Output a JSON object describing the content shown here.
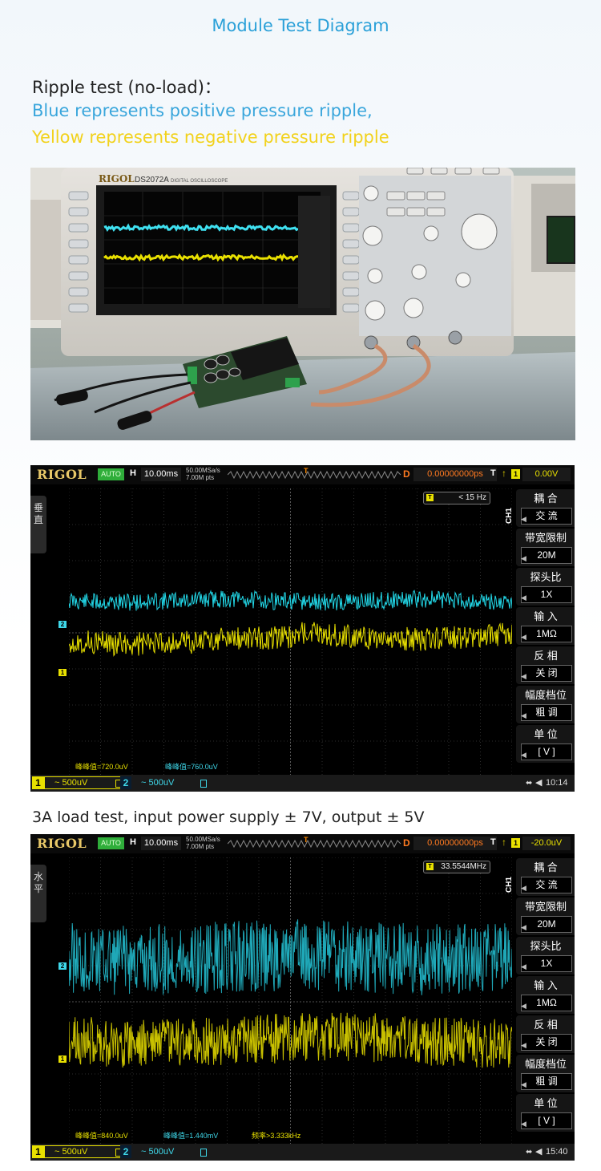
{
  "page": {
    "title": "Module Test Diagram",
    "ripple_heading": "Ripple test (no-load)：",
    "blue_caption": "Blue represents positive pressure ripple,",
    "yellow_caption": "Yellow represents negative pressure ripple",
    "load_heading": "3A load test, input power supply ± 7V, output ± 5V"
  },
  "photo": {
    "scope_brand": "RIGOL",
    "scope_model": "DS2072A",
    "scope_desc": "DIGITAL OSCILLOSCOPE"
  },
  "scope1": {
    "brand": "RIGOL",
    "mode": "AUTO",
    "h_label": "H",
    "timebase": "10.00ms",
    "sample_rate": "50.00MSa/s",
    "mem_depth": "7.00M pts",
    "d_label": "D",
    "delay": "0.00000000ps",
    "t_label": "T",
    "trigger_source": "1",
    "trigger_level": "0.00V",
    "side_tab": "垂直",
    "freq_readout": "< 15 Hz",
    "channel_title": "CH1",
    "menu": [
      {
        "title": "耦 合",
        "value": "交 流"
      },
      {
        "title": "带宽限制",
        "value": "20M"
      },
      {
        "title": "探头比",
        "value": "1X"
      },
      {
        "title": "输 入",
        "value": "1MΩ"
      },
      {
        "title": "反 相",
        "value": "关 闭"
      },
      {
        "title": "幅度档位",
        "value": "粗 调"
      },
      {
        "title": "单 位",
        "value": "[ V ]"
      }
    ],
    "measure_ch1": "峰峰值=720.0uV",
    "measure_ch2": "峰峰值=760.0uV",
    "ch1_tag": "1",
    "ch1_scale": "~ 500uV",
    "ch2_tag": "2",
    "ch2_scale": "~ 500uV",
    "time": "10:14",
    "ch_marker_1": "1",
    "ch_marker_2": "2"
  },
  "scope2": {
    "brand": "RIGOL",
    "mode": "AUTO",
    "h_label": "H",
    "timebase": "10.00ms",
    "sample_rate": "50.00MSa/s",
    "mem_depth": "7.00M pts",
    "d_label": "D",
    "delay": "0.00000000ps",
    "t_label": "T",
    "trigger_source": "1",
    "trigger_level": "-20.0uV",
    "side_tab": "水平",
    "freq_readout": "33.5544MHz",
    "channel_title": "CH1",
    "menu": [
      {
        "title": "耦 合",
        "value": "交 流"
      },
      {
        "title": "带宽限制",
        "value": "20M"
      },
      {
        "title": "探头比",
        "value": "1X"
      },
      {
        "title": "输 入",
        "value": "1MΩ"
      },
      {
        "title": "反 相",
        "value": "关 闭"
      },
      {
        "title": "幅度档位",
        "value": "粗 调"
      },
      {
        "title": "单 位",
        "value": "[ V ]"
      }
    ],
    "measure_ch1": "峰峰值=840.0uV",
    "measure_ch2": "峰峰值=1.440mV",
    "measure_freq": "频率>3.333kHz",
    "ch1_tag": "1",
    "ch1_scale": "~ 500uV",
    "ch2_tag": "2",
    "ch2_scale": "~ 500uV",
    "time": "15:40",
    "ch_marker_1": "1",
    "ch_marker_2": "2"
  },
  "colors": {
    "title_blue": "#2aa0d8",
    "trace_cyan": "#22d8e8",
    "trace_yellow": "#e8e000",
    "brand_gold": "#e8c868",
    "auto_green": "#2fae3a",
    "delay_orange": "#ff7a20"
  },
  "icons": [
    "usb-icon",
    "speaker-icon",
    "trigger-marker-icon",
    "channel-marker-icon"
  ]
}
